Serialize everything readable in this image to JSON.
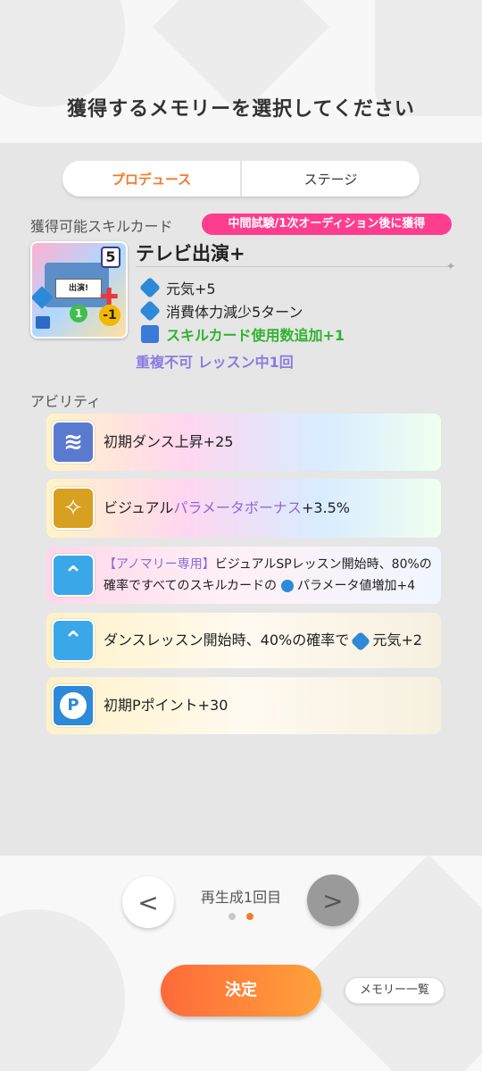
{
  "header": {
    "title": "獲得するメモリーを選択してください"
  },
  "tabs": [
    {
      "label": "プロデュース",
      "active": true
    },
    {
      "label": "ステージ",
      "active": false
    }
  ],
  "skill_section": {
    "label": "獲得可能スキルカード",
    "badge": "中間試験/1次オーディション後に獲得",
    "card": {
      "cost": "5",
      "sign_text": "出演!",
      "badge_green": "1",
      "badge_yellow": "-1"
    },
    "name": "テレビ出演+",
    "effects": [
      "元気+5",
      "消費体力減少5ターン",
      "スキルカード使用数追加+1"
    ],
    "note": "重複不可 レッスン中1回"
  },
  "ability_section": {
    "label": "アビリティ",
    "items": [
      {
        "text": "初期ダンス上昇+25"
      },
      {
        "prefix": "ビジュアル",
        "highlight": "パラメータボーナス",
        "suffix": "+3.5%"
      },
      {
        "tag": "【アノマリー専用】",
        "text": "ビジュアルSPレッスン開始時、80%の確率ですべてのスキルカードの",
        "suffix": "パラメータ値増加+4"
      },
      {
        "text": "ダンスレッスン開始時、40%の確率で",
        "suffix": "元気+2"
      },
      {
        "text": "初期Pポイント+30",
        "icon_letter": "P"
      }
    ]
  },
  "footer": {
    "regen_label": "再生成1回目",
    "prev_symbol": "<",
    "next_symbol": ">",
    "decide_label": "決定",
    "memory_list_label": "メモリー一覧"
  },
  "colors": {
    "accent": "#f47a2a",
    "badge": "#ff3d8f",
    "green": "#2fb32f",
    "purple": "#8c7ae0"
  }
}
